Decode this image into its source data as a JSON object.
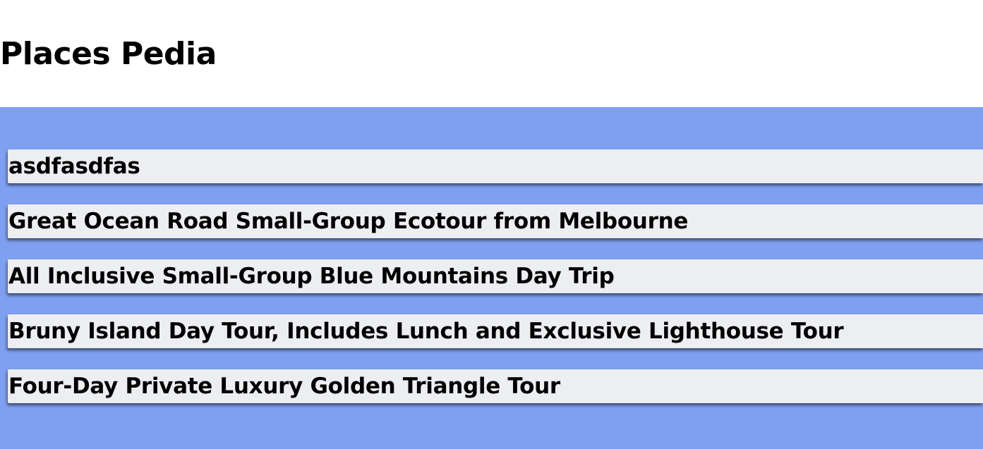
{
  "header": {
    "title": "Places Pedia"
  },
  "colors": {
    "content_background": "#7f9ff0",
    "card_background": "#edeef2",
    "text": "#000000"
  },
  "places": {
    "items": [
      {
        "title": "asdfasdfas"
      },
      {
        "title": "Great Ocean Road Small-Group Ecotour from Melbourne"
      },
      {
        "title": "All Inclusive Small-Group Blue Mountains Day Trip"
      },
      {
        "title": "Bruny Island Day Tour, Includes Lunch and Exclusive Lighthouse Tour"
      },
      {
        "title": "Four-Day Private Luxury Golden Triangle Tour"
      }
    ]
  }
}
